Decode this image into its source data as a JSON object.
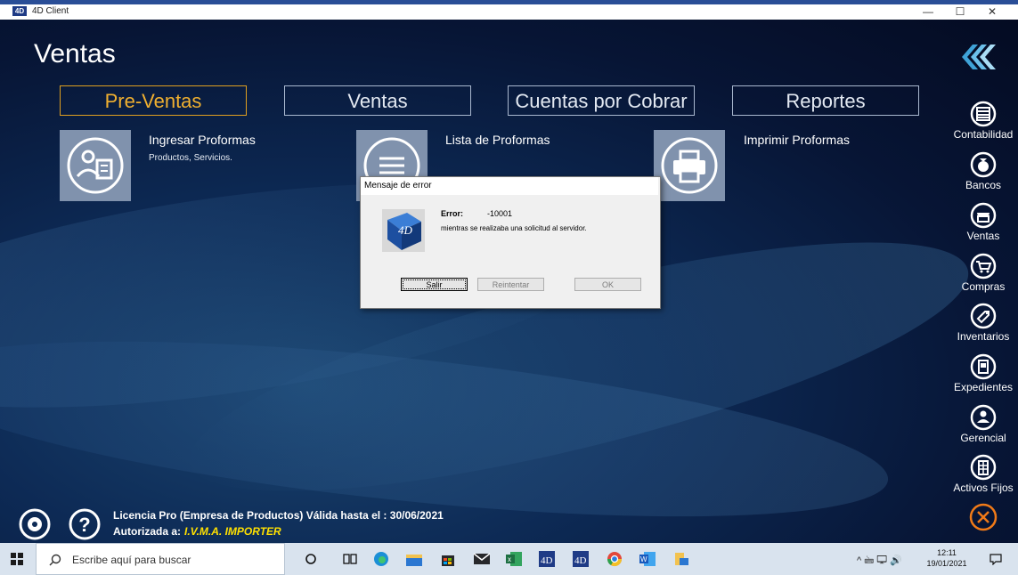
{
  "window": {
    "app_title": "4D Client",
    "icon_text": "4D",
    "minimize": "—",
    "maximize": "☐",
    "close": "✕"
  },
  "section_title": "Ventas",
  "tabs": [
    {
      "label": "Pre-Ventas",
      "active": true
    },
    {
      "label": "Ventas",
      "active": false
    },
    {
      "label": "Cuentas por Cobrar",
      "active": false
    },
    {
      "label": "Reportes",
      "active": false
    }
  ],
  "actions": [
    {
      "title": "Ingresar Proformas",
      "subtitle": "Productos, Servicios.",
      "icon": "user-form-icon"
    },
    {
      "title": "Lista de Proformas",
      "subtitle": "",
      "icon": "list-icon"
    },
    {
      "title": "Imprimir Proformas",
      "subtitle": "",
      "icon": "printer-icon"
    }
  ],
  "right_nav": [
    {
      "label": "Contabilidad",
      "icon": "abacus-icon"
    },
    {
      "label": "Bancos",
      "icon": "money-bag-icon"
    },
    {
      "label": "Ventas",
      "icon": "storefront-icon"
    },
    {
      "label": "Compras",
      "icon": "cart-icon"
    },
    {
      "label": "Inventarios",
      "icon": "tag-icon"
    },
    {
      "label": "Expedientes",
      "icon": "folder-icon"
    },
    {
      "label": "Gerencial",
      "icon": "manager-icon"
    },
    {
      "label": "Activos Fijos",
      "icon": "building-icon"
    }
  ],
  "dialog": {
    "title": "Mensaje de error",
    "error_label": "Error:",
    "error_code": "-10001",
    "message": "mientras se realizaba una solicitud al servidor.",
    "buttons": {
      "salir": "Salir",
      "reintentar": "Reintentar",
      "ok": "OK"
    }
  },
  "license": {
    "line1": "Licencia Pro (Empresa de Productos) Válida hasta el : 30/06/2021",
    "authorized_label": "Autorizada a:",
    "authorized_to": "I.V.M.A. IMPORTER"
  },
  "taskbar": {
    "search_placeholder": "Escribe aquí para buscar",
    "time": "12:11",
    "date": "19/01/2021",
    "tray": "^ 🖮 🖵 🔊"
  },
  "colors": {
    "accent": "#f0b030",
    "license_highlight": "#ffe000",
    "exit": "#f07a18"
  }
}
